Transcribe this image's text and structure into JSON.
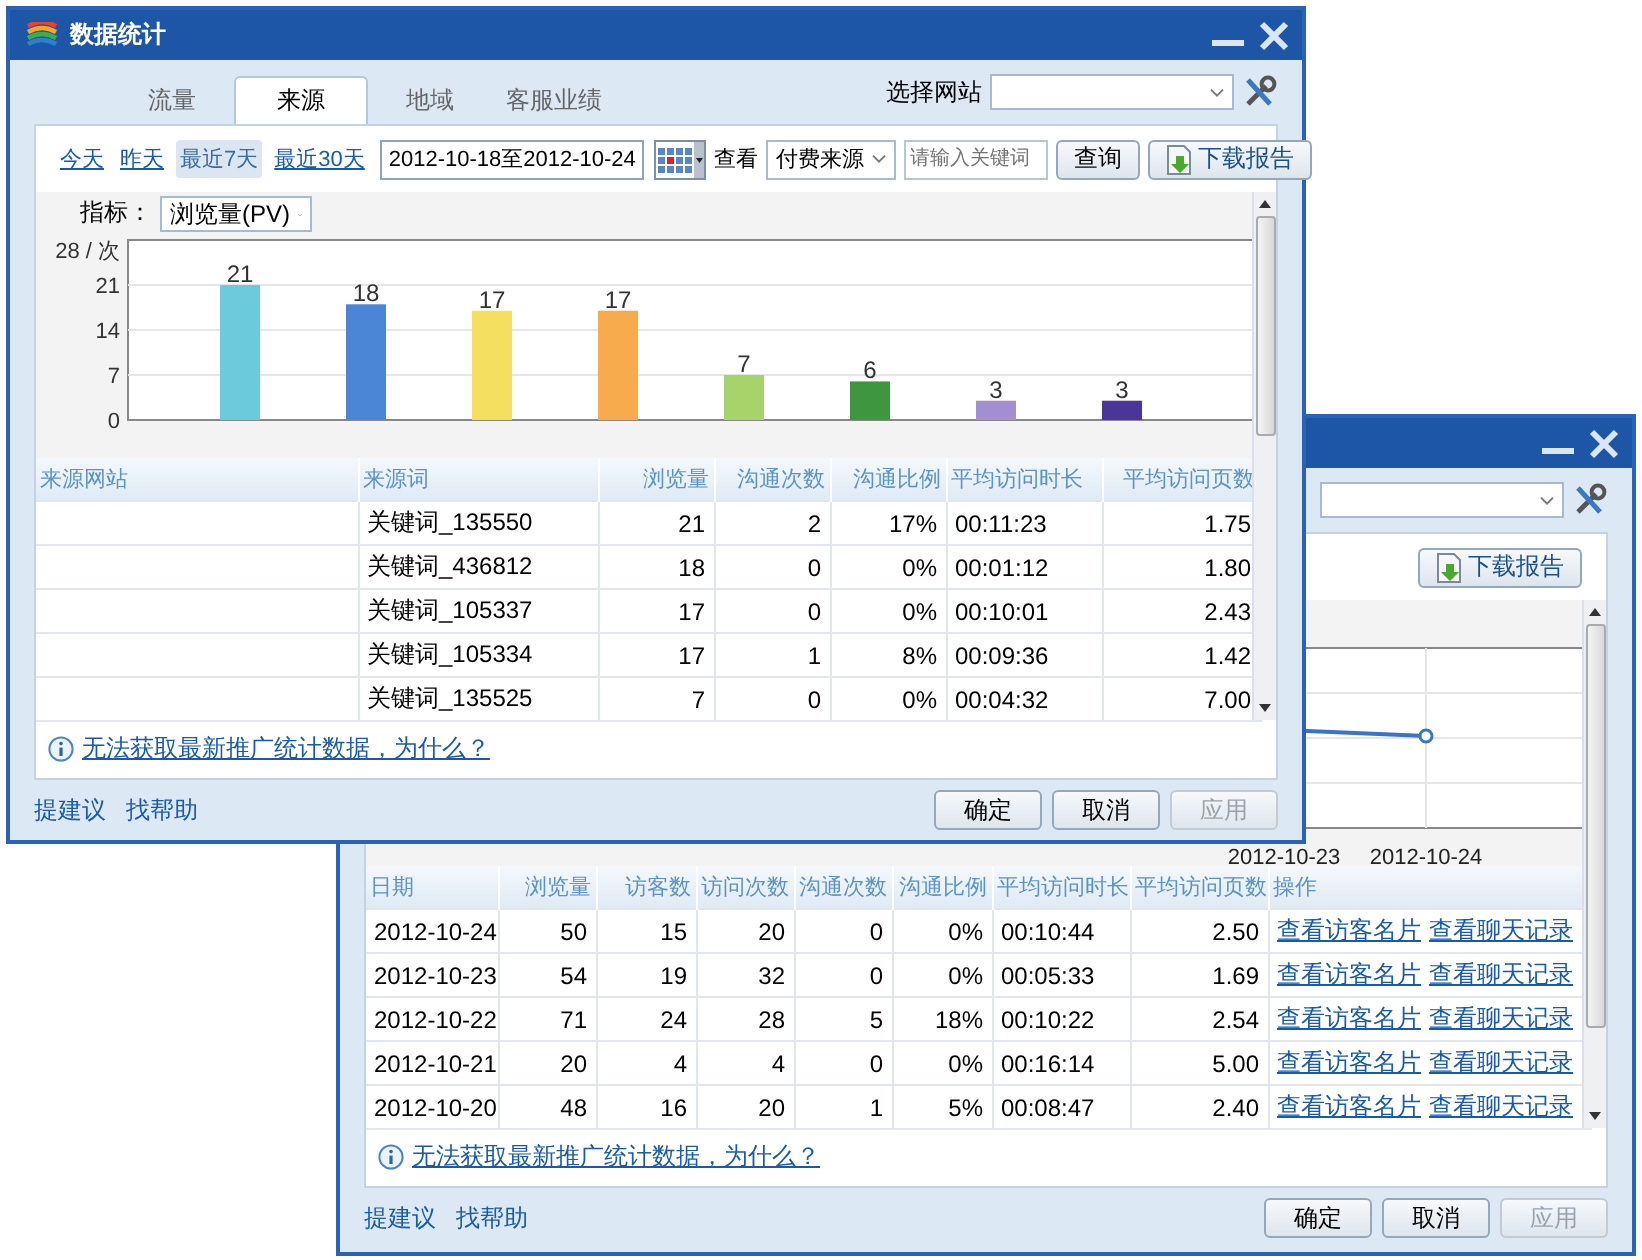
{
  "windows": [
    {
      "kind": "keywords",
      "title": "数据统计",
      "tabs": [
        {
          "label": "流量",
          "selected": false
        },
        {
          "label": "来源",
          "selected": true
        },
        {
          "label": "地域",
          "selected": false
        },
        {
          "label": "客服业绩",
          "selected": false
        }
      ],
      "site_label": "选择网站",
      "date_links": [
        {
          "label": "今天",
          "selected": false
        },
        {
          "label": "昨天",
          "selected": false
        },
        {
          "label": "最近7天",
          "selected": true
        },
        {
          "label": "最近30天",
          "selected": false
        }
      ],
      "date_range": "2012-10-18至2012-10-24",
      "view_label": "查看",
      "view_select": "付费来源",
      "keyword_field": {
        "placeholder": "请输入关键词"
      },
      "query_button": "查询",
      "download_button": "下载报告",
      "metric_label": "指标：",
      "metric_select": "浏览量(PV)",
      "chart": {
        "chart_data": {
          "type": "bar",
          "grid": true,
          "ylim": [
            0,
            28
          ],
          "yticks": [
            0,
            7,
            14,
            21,
            {
              "value": 28,
              "label": "28 / 次"
            }
          ],
          "data_labels": true,
          "series": [
            {
              "values": [
                21,
                18,
                17,
                17,
                7,
                6,
                3,
                3
              ]
            }
          ],
          "colors": [
            "#6ccadd",
            "#4b86d6",
            "#f4e05e",
            "#f8ab4c",
            "#a6d46a",
            "#3e973f",
            "#a48ed2",
            "#4b3598"
          ]
        }
      },
      "table": {
        "columns": [
          "来源网站",
          "来源词",
          "浏览量",
          "沟通次数",
          "沟通比例",
          "平均访问时长",
          "平均访问页数"
        ],
        "rows": [
          {
            "keyword": "关键词_135550",
            "views": "21",
            "chats": "2",
            "chat_rate": "17%",
            "avg_duration": "00:11:23",
            "avg_pages": "1.75"
          },
          {
            "keyword": "关键词_436812",
            "views": "18",
            "chats": "0",
            "chat_rate": "0%",
            "avg_duration": "00:01:12",
            "avg_pages": "1.80"
          },
          {
            "keyword": "关键词_105337",
            "views": "17",
            "chats": "0",
            "chat_rate": "0%",
            "avg_duration": "00:10:01",
            "avg_pages": "2.43"
          },
          {
            "keyword": "关键词_105334",
            "views": "17",
            "chats": "1",
            "chat_rate": "8%",
            "avg_duration": "00:09:36",
            "avg_pages": "1.42"
          },
          {
            "keyword": "关键词_135525",
            "views": "7",
            "chats": "0",
            "chat_rate": "0%",
            "avg_duration": "00:04:32",
            "avg_pages": "7.00"
          }
        ]
      },
      "info_link": "无法获取最新推广统计数据，为什么？",
      "footer_links": [
        "提建议",
        "找帮助"
      ],
      "buttons": [
        {
          "label": "确定",
          "disabled": false
        },
        {
          "label": "取消",
          "disabled": false
        },
        {
          "label": "应用",
          "disabled": true
        }
      ]
    },
    {
      "kind": "daily",
      "download_button": "下载报告",
      "chart": {
        "x_labels": [
          "2012-10-23",
          "2012-10-24"
        ]
      },
      "table": {
        "columns": [
          "日期",
          "浏览量",
          "访客数",
          "访问次数",
          "沟通次数",
          "沟通比例",
          "平均访问时长",
          "平均访问页数",
          "操作"
        ],
        "rows": [
          {
            "date": "2012-10-24",
            "views": "50",
            "visitors": "15",
            "visits": "20",
            "chats": "0",
            "chat_rate": "0%",
            "avg_duration": "00:10:44",
            "avg_pages": "2.50",
            "actions": [
              "查看访客名片",
              "查看聊天记录"
            ]
          },
          {
            "date": "2012-10-23",
            "views": "54",
            "visitors": "19",
            "visits": "32",
            "chats": "0",
            "chat_rate": "0%",
            "avg_duration": "00:05:33",
            "avg_pages": "1.69",
            "actions": [
              "查看访客名片",
              "查看聊天记录"
            ]
          },
          {
            "date": "2012-10-22",
            "views": "71",
            "visitors": "24",
            "visits": "28",
            "chats": "5",
            "chat_rate": "18%",
            "avg_duration": "00:10:22",
            "avg_pages": "2.54",
            "actions": [
              "查看访客名片",
              "查看聊天记录"
            ]
          },
          {
            "date": "2012-10-21",
            "views": "20",
            "visitors": "4",
            "visits": "4",
            "chats": "0",
            "chat_rate": "0%",
            "avg_duration": "00:16:14",
            "avg_pages": "5.00",
            "actions": [
              "查看访客名片",
              "查看聊天记录"
            ]
          },
          {
            "date": "2012-10-20",
            "views": "48",
            "visitors": "16",
            "visits": "20",
            "chats": "1",
            "chat_rate": "5%",
            "avg_duration": "00:08:47",
            "avg_pages": "2.40",
            "actions": [
              "查看访客名片",
              "查看聊天记录"
            ]
          }
        ]
      },
      "info_link": "无法获取最新推广统计数据，为什么？",
      "footer_links": [
        "提建议",
        "找帮助"
      ],
      "buttons": [
        {
          "label": "确定",
          "disabled": false
        },
        {
          "label": "取消",
          "disabled": false
        },
        {
          "label": "应用",
          "disabled": true
        }
      ]
    }
  ]
}
